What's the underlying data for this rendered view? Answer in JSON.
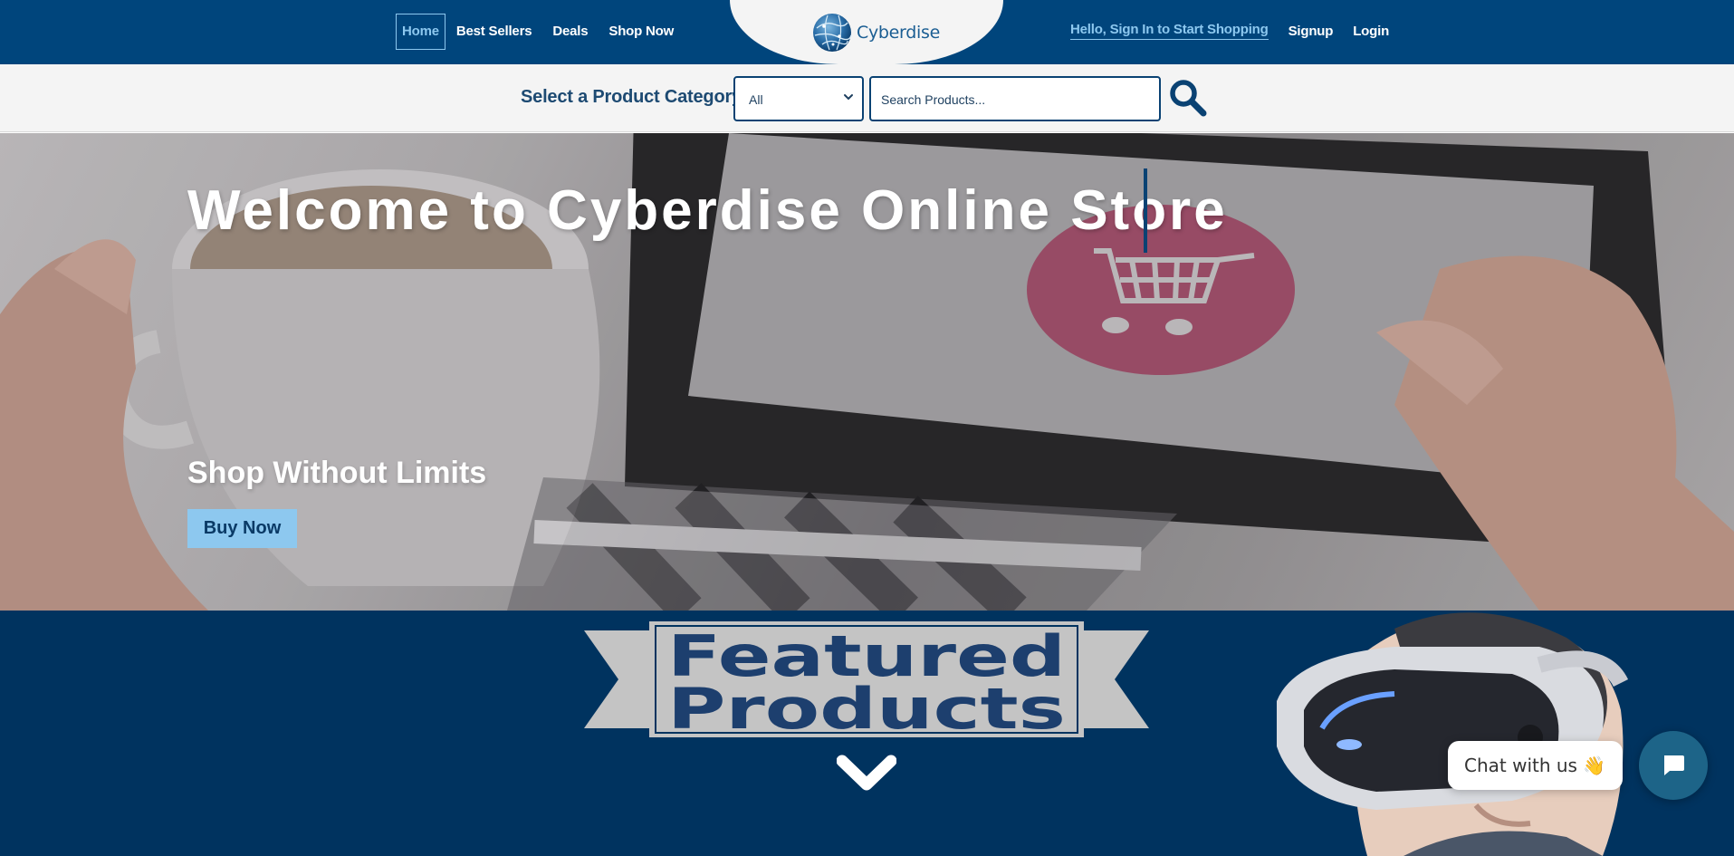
{
  "nav": {
    "links": [
      {
        "label": "Home",
        "active": true
      },
      {
        "label": "Best Sellers"
      },
      {
        "label": "Deals"
      },
      {
        "label": "Shop Now"
      }
    ],
    "brand": "Cyberdise",
    "signin": "Hello, Sign In to Start Shopping",
    "signup": "Signup",
    "login": "Login"
  },
  "search": {
    "category_label": "Select a Product Category",
    "category_value": "All",
    "placeholder": "Search Products...",
    "icon": "search-icon"
  },
  "hero": {
    "title": "Welcome to Cyberdise Online Store",
    "subtitle": "Shop Without Limits",
    "cta": "Buy Now"
  },
  "featured": {
    "line1": "Featured",
    "line2": "Products",
    "icon": "chevron-down-icon"
  },
  "chat": {
    "label": "Chat with us",
    "emoji": "👋",
    "icon": "chat-bubble-icon"
  },
  "colors": {
    "primary": "#00457c",
    "dark": "#00335f",
    "accent": "#8dc8ef",
    "chat": "#1d6488"
  }
}
